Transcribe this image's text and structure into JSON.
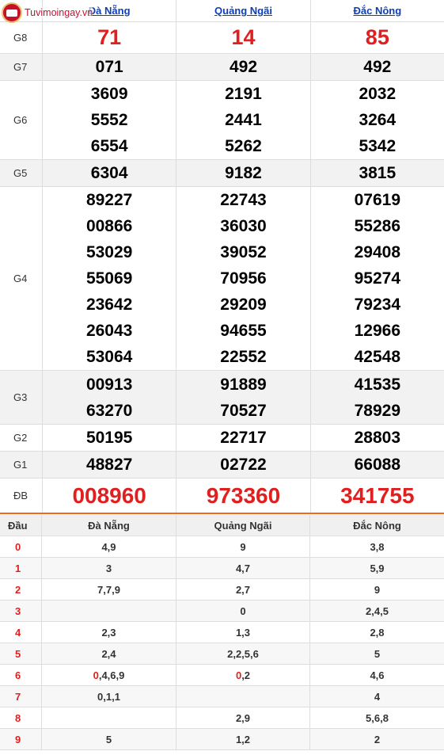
{
  "logo": {
    "text": "Tuvimoingay.vn"
  },
  "provinces": [
    "Đà Nẵng",
    "Quảng Ngãi",
    "Đắc Nông"
  ],
  "prizes": [
    {
      "label": "G8",
      "values": [
        [
          "71"
        ],
        [
          "14"
        ],
        [
          "85"
        ]
      ]
    },
    {
      "label": "G7",
      "values": [
        [
          "071"
        ],
        [
          "492"
        ],
        [
          "492"
        ]
      ]
    },
    {
      "label": "G6",
      "values": [
        [
          "3609",
          "5552",
          "6554"
        ],
        [
          "2191",
          "2441",
          "5262"
        ],
        [
          "2032",
          "3264",
          "5342"
        ]
      ]
    },
    {
      "label": "G5",
      "values": [
        [
          "6304"
        ],
        [
          "9182"
        ],
        [
          "3815"
        ]
      ]
    },
    {
      "label": "G4",
      "values": [
        [
          "89227",
          "00866",
          "53029",
          "55069",
          "23642",
          "26043",
          "53064"
        ],
        [
          "22743",
          "36030",
          "39052",
          "70956",
          "29209",
          "94655",
          "22552"
        ],
        [
          "07619",
          "55286",
          "29408",
          "95274",
          "79234",
          "12966",
          "42548"
        ]
      ]
    },
    {
      "label": "G3",
      "values": [
        [
          "00913",
          "63270"
        ],
        [
          "91889",
          "70527"
        ],
        [
          "41535",
          "78929"
        ]
      ]
    },
    {
      "label": "G2",
      "values": [
        [
          "50195"
        ],
        [
          "22717"
        ],
        [
          "28803"
        ]
      ]
    },
    {
      "label": "G1",
      "values": [
        [
          "48827"
        ],
        [
          "02722"
        ],
        [
          "66088"
        ]
      ]
    },
    {
      "label": "ĐB",
      "values": [
        [
          "008960"
        ],
        [
          "973360"
        ],
        [
          "341755"
        ]
      ]
    }
  ],
  "loto": {
    "header": {
      "dau": "Đầu",
      "cols": [
        "Đà Nẵng",
        "Quảng Ngãi",
        "Đắc Nông"
      ]
    },
    "rows": [
      {
        "dau": "0",
        "cells": [
          "4,9",
          "9",
          "3,8"
        ]
      },
      {
        "dau": "1",
        "cells": [
          "3",
          "4,7",
          "5,9"
        ]
      },
      {
        "dau": "2",
        "cells": [
          "7,7,9",
          "2,7",
          "9"
        ]
      },
      {
        "dau": "3",
        "cells": [
          "",
          "0",
          "2,4,5"
        ]
      },
      {
        "dau": "4",
        "cells": [
          "2,3",
          "1,3",
          "2,8"
        ]
      },
      {
        "dau": "5",
        "cells": [
          "2,4",
          "2,2,5,6",
          "5"
        ]
      },
      {
        "dau": "6",
        "cells": [
          "0,4,6,9",
          "0,2",
          "4,6"
        ]
      },
      {
        "dau": "7",
        "cells": [
          "0,1,1",
          "",
          "4"
        ]
      },
      {
        "dau": "8",
        "cells": [
          "",
          "2,9",
          "5,6,8"
        ]
      },
      {
        "dau": "9",
        "cells": [
          "5",
          "1,2",
          "2"
        ]
      }
    ]
  },
  "colors": {
    "accent_red": "#e02020",
    "link_blue": "#0c3fb8",
    "divider_orange": "#f06a1a"
  }
}
